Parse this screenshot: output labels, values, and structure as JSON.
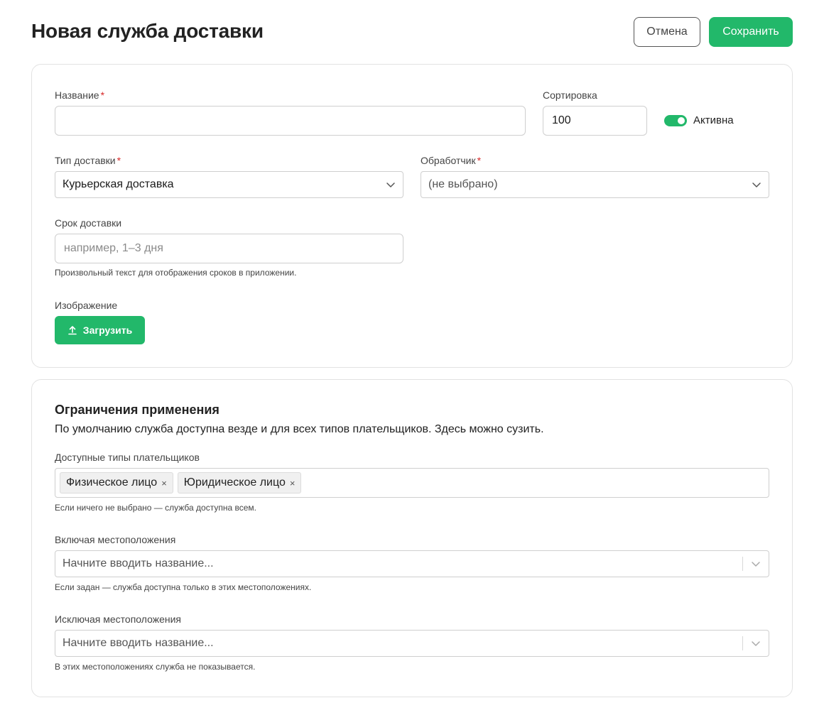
{
  "header": {
    "title": "Новая служба доставки",
    "cancel_label": "Отмена",
    "save_label": "Сохранить"
  },
  "main": {
    "name": {
      "label": "Название",
      "required_mark": "*",
      "value": ""
    },
    "sort": {
      "label": "Сортировка",
      "value": "100"
    },
    "active": {
      "label": "Активна",
      "checked": true
    },
    "delivery_type": {
      "label": "Тип доставки",
      "required_mark": "*",
      "value": "Курьерская доставка"
    },
    "handler": {
      "label": "Обработчик",
      "required_mark": "*",
      "value": "(не выбрано)"
    },
    "delivery_time": {
      "label": "Срок доставки",
      "placeholder": "например, 1–3 дня",
      "hint": "Произвольный текст для отображения сроков в приложении."
    },
    "image": {
      "label": "Изображение",
      "upload_label": "Загрузить"
    }
  },
  "limits": {
    "title": "Ограничения применения",
    "description": "По умолчанию служба доступна везде и для всех типов плательщиков. Здесь можно сузить.",
    "payer_types": {
      "label": "Доступные типы плательщиков",
      "chips": [
        "Физическое лицо",
        "Юридическое лицо"
      ],
      "remove_glyph": "×",
      "hint": "Если ничего не выбрано — служба доступна всем."
    },
    "include_locations": {
      "label": "Включая местоположения",
      "placeholder": "Начните вводить название...",
      "hint": "Если задан — служба доступна только в этих местоположениях."
    },
    "exclude_locations": {
      "label": "Исключая местоположения",
      "placeholder": "Начните вводить название...",
      "hint": "В этих местоположениях служба не показывается."
    }
  },
  "colors": {
    "accent": "#22b86a",
    "required": "#d62828"
  },
  "icons": {
    "upload": "upload-icon",
    "chevron": "chevron-down-icon"
  }
}
